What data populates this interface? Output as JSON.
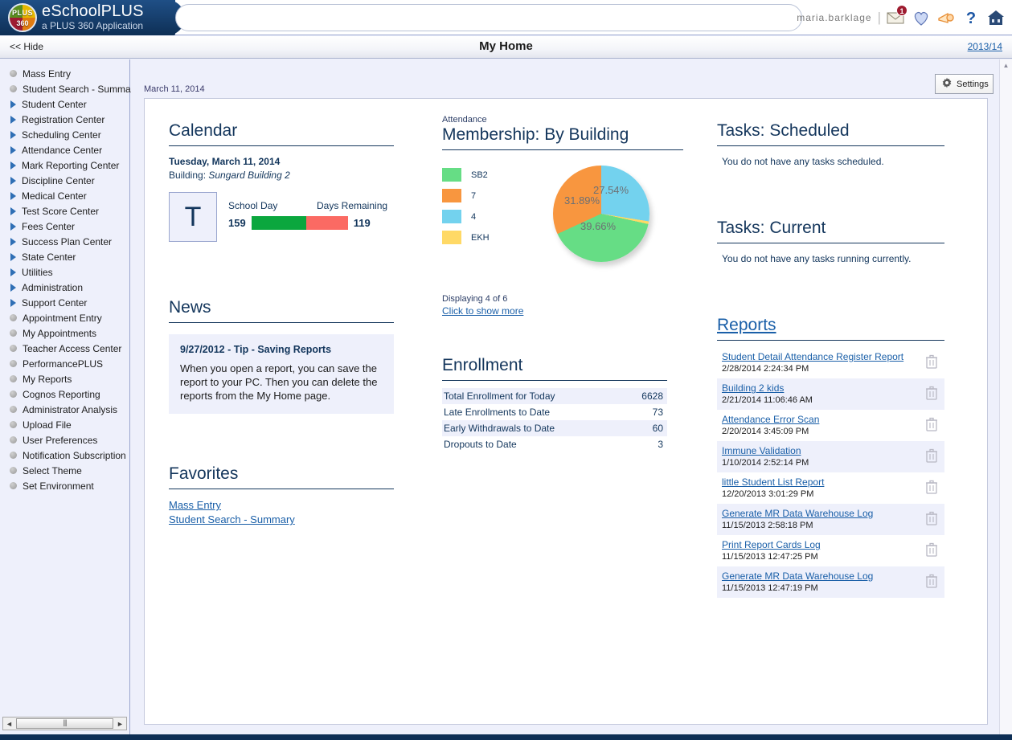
{
  "brand": {
    "logo_top": "PLUS",
    "logo_bottom": "360",
    "name": "eSchoolPLUS",
    "tagline": "a PLUS 360 Application",
    "logo_icon": "plus360-logo-icon"
  },
  "topbar": {
    "username": "maria.barklage",
    "mail_badge_count": "1",
    "icons": [
      "mail-icon",
      "heart-icon",
      "megaphone-icon",
      "help-icon",
      "home-icon"
    ],
    "search_placeholder": ""
  },
  "pagehead": {
    "hide_label": "<< Hide",
    "title": "My Home",
    "school_year": "2013/14"
  },
  "sidebar": {
    "items": [
      {
        "label": "Mass Entry",
        "marker": "bullet"
      },
      {
        "label": "Student Search - Summary",
        "marker": "bullet"
      },
      {
        "label": "Student Center",
        "marker": "arrow"
      },
      {
        "label": "Registration Center",
        "marker": "arrow"
      },
      {
        "label": "Scheduling Center",
        "marker": "arrow"
      },
      {
        "label": "Attendance Center",
        "marker": "arrow"
      },
      {
        "label": "Mark Reporting Center",
        "marker": "arrow"
      },
      {
        "label": "Discipline Center",
        "marker": "arrow"
      },
      {
        "label": "Medical Center",
        "marker": "arrow"
      },
      {
        "label": "Test Score Center",
        "marker": "arrow"
      },
      {
        "label": "Fees Center",
        "marker": "arrow"
      },
      {
        "label": "Success Plan Center",
        "marker": "arrow"
      },
      {
        "label": "State Center",
        "marker": "arrow"
      },
      {
        "label": "Utilities",
        "marker": "arrow"
      },
      {
        "label": "Administration",
        "marker": "arrow"
      },
      {
        "label": "Support Center",
        "marker": "arrow"
      },
      {
        "label": "Appointment Entry",
        "marker": "bullet"
      },
      {
        "label": "My Appointments",
        "marker": "bullet"
      },
      {
        "label": "Teacher Access Center",
        "marker": "bullet"
      },
      {
        "label": "PerformancePLUS",
        "marker": "bullet"
      },
      {
        "label": "My Reports",
        "marker": "bullet"
      },
      {
        "label": "Cognos Reporting",
        "marker": "bullet"
      },
      {
        "label": "Administrator Analysis",
        "marker": "bullet"
      },
      {
        "label": "Upload File",
        "marker": "bullet"
      },
      {
        "label": "User Preferences",
        "marker": "bullet"
      },
      {
        "label": "Notification Subscription",
        "marker": "bullet"
      },
      {
        "label": "Select Theme",
        "marker": "bullet"
      },
      {
        "label": "Set Environment",
        "marker": "bullet"
      }
    ]
  },
  "main": {
    "datestamp": "March 11, 2014",
    "settings_label": "Settings",
    "settings_icon": "gear-icon"
  },
  "calendar": {
    "title": "Calendar",
    "date": "Tuesday, March 11, 2014",
    "building_label": "Building:",
    "building_name": "Sungard Building 2",
    "day_letter": "T",
    "school_day_label": "School Day",
    "days_remaining_label": "Days Remaining",
    "school_day_value": "159",
    "days_remaining_value": "119",
    "green_color": "#0ba73e",
    "red_color": "#fb6a63"
  },
  "news": {
    "title": "News",
    "item_title": "9/27/2012 - Tip - Saving Reports",
    "item_body": "When you open a report, you can save the report to your PC. Then you can delete the reports from the My Home page."
  },
  "favorites": {
    "title": "Favorites",
    "links": [
      "Mass Entry",
      "Student Search - Summary"
    ]
  },
  "membership": {
    "eyebrow": "Attendance",
    "title": "Membership: By Building",
    "footer": "Displaying 4 of 6",
    "more_link": "Click to show more"
  },
  "chart_data": {
    "type": "pie",
    "title": "Membership: By Building",
    "subtitle": "Attendance",
    "categories": [
      "SB2",
      "7",
      "4",
      "EKH"
    ],
    "values": [
      39.66,
      31.89,
      27.54,
      0.91
    ],
    "value_labels": [
      "39.66%",
      "31.89%",
      "27.54%",
      ""
    ],
    "colors": [
      "#66dd85",
      "#f8963f",
      "#73d2ee",
      "#ffd966"
    ],
    "legend_position": "left",
    "units": "percent",
    "start_angle_deg": 0,
    "direction": "clockwise",
    "grid": false
  },
  "enrollment": {
    "title": "Enrollment",
    "rows": [
      {
        "label": "Total Enrollment for Today",
        "value": "6628"
      },
      {
        "label": "Late Enrollments to Date",
        "value": "73"
      },
      {
        "label": "Early Withdrawals to Date",
        "value": "60"
      },
      {
        "label": "Dropouts to Date",
        "value": "3"
      }
    ]
  },
  "tasks_scheduled": {
    "title": "Tasks: Scheduled",
    "message": "You do not have any tasks scheduled."
  },
  "tasks_current": {
    "title": "Tasks: Current",
    "message": "You do not have any tasks running currently."
  },
  "reports": {
    "title": "Reports",
    "delete_icon": "trash-icon",
    "rows": [
      {
        "name": "Student Detail Attendance Register Report",
        "time": "2/28/2014 2:24:34 PM"
      },
      {
        "name": "Building 2 kids",
        "time": "2/21/2014 11:06:46 AM"
      },
      {
        "name": "Attendance Error Scan",
        "time": "2/20/2014 3:45:09 PM"
      },
      {
        "name": "Immune Validation",
        "time": "1/10/2014 2:52:14 PM"
      },
      {
        "name": "little Student List Report",
        "time": "12/20/2013 3:01:29 PM"
      },
      {
        "name": "Generate MR Data Warehouse Log",
        "time": "11/15/2013 2:58:18 PM"
      },
      {
        "name": "Print Report Cards Log",
        "time": "11/15/2013 12:47:25 PM"
      },
      {
        "name": "Generate MR Data Warehouse Log",
        "time": "11/15/2013 12:47:19 PM"
      }
    ]
  },
  "scrollbars": {
    "left_arrow": "◄",
    "right_arrow": "►",
    "up_arrow": "▲"
  }
}
